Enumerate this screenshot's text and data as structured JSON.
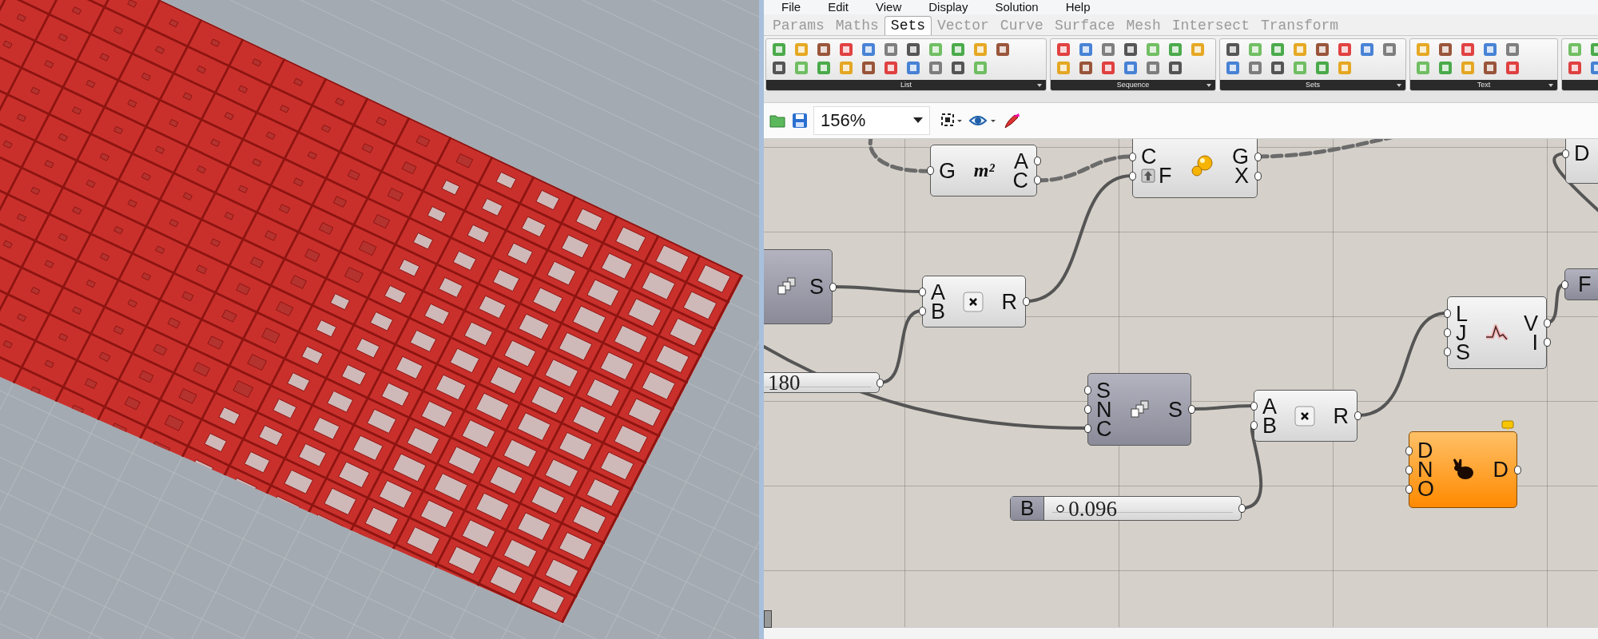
{
  "menu": [
    "File",
    "Edit",
    "View",
    "Display",
    "Solution",
    "Help"
  ],
  "tabs": [
    {
      "label": "Params",
      "selected": false
    },
    {
      "label": "Maths",
      "selected": false
    },
    {
      "label": "Sets",
      "selected": true
    },
    {
      "label": "Vector",
      "selected": false
    },
    {
      "label": "Curve",
      "selected": false
    },
    {
      "label": "Surface",
      "selected": false
    },
    {
      "label": "Mesh",
      "selected": false
    },
    {
      "label": "Intersect",
      "selected": false
    },
    {
      "label": "Transform",
      "selected": false
    }
  ],
  "ribbon_groups": [
    "List",
    "Sequence",
    "Sets",
    "Text"
  ],
  "canvas_toolbar": {
    "zoom": "156%"
  },
  "nodes": [
    {
      "kind": "area",
      "inputs": [
        "G"
      ],
      "symbol": "m²",
      "outputs": [
        "A",
        "C"
      ],
      "preview": true,
      "warning": false
    },
    {
      "kind": "spheres",
      "inputs": [
        "C",
        "F"
      ],
      "outputs": [
        "G",
        "X"
      ],
      "preview": true,
      "warning": false
    },
    {
      "kind": "partial",
      "inputs": [
        "D"
      ],
      "preview": true,
      "warning": false
    },
    {
      "kind": "series",
      "outputs": [
        "S"
      ],
      "preview": false,
      "warning": false
    },
    {
      "kind": "multiply",
      "inputs": [
        "A",
        "B"
      ],
      "outputs": [
        "R"
      ],
      "preview": true,
      "warning": false
    },
    {
      "kind": "slider",
      "value": "180",
      "preview": true,
      "warning": false
    },
    {
      "kind": "series",
      "inputs": [
        "S",
        "N",
        "C"
      ],
      "outputs": [
        "S"
      ],
      "preview": false,
      "warning": false
    },
    {
      "kind": "multiply",
      "inputs": [
        "A",
        "B"
      ],
      "outputs": [
        "R"
      ],
      "preview": true,
      "warning": false
    },
    {
      "kind": "graph",
      "inputs": [
        "L",
        "J",
        "S"
      ],
      "outputs": [
        "V",
        "I"
      ],
      "preview": true,
      "warning": false
    },
    {
      "kind": "param",
      "label": "F",
      "preview": false,
      "warning": false
    },
    {
      "kind": "dispatch",
      "inputs": [
        "D",
        "N",
        "O"
      ],
      "outputs": [
        "D"
      ],
      "preview": true,
      "warning": true
    },
    {
      "kind": "slider",
      "name": "B",
      "value": "0.096",
      "preview": true,
      "warning": false
    }
  ]
}
